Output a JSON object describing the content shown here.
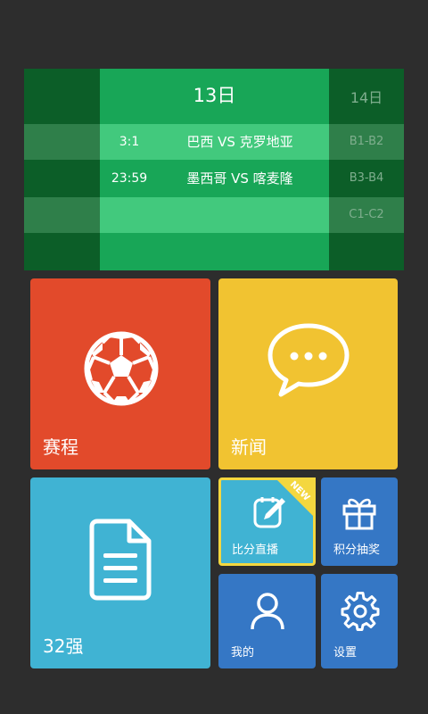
{
  "schedule_board": {
    "current_day": "13日",
    "next_day": "14日",
    "matches": [
      {
        "time": "3:1",
        "teams": "巴西 VS 克罗地亚"
      },
      {
        "time": "23:59",
        "teams": "墨西哥 VS 喀麦隆"
      }
    ],
    "groups": [
      "B1-B2",
      "B3-B4",
      "C1-C2"
    ]
  },
  "tiles": {
    "schedule": {
      "label": "赛程",
      "icon": "soccer-ball-icon",
      "color": "#e24a2b"
    },
    "news": {
      "label": "新闻",
      "icon": "chat-bubble-icon",
      "color": "#f1c331"
    },
    "top32": {
      "label": "32强",
      "icon": "document-icon",
      "color": "#40b3d3"
    },
    "live_score": {
      "label": "比分直播",
      "icon": "edit-note-icon",
      "badge": "NEW",
      "color": "#40b3d3"
    },
    "lottery": {
      "label": "积分抽奖",
      "icon": "gift-icon",
      "color": "#3577c5"
    },
    "mine": {
      "label": "我的",
      "icon": "user-icon",
      "color": "#3577c5"
    },
    "settings": {
      "label": "设置",
      "icon": "gear-icon",
      "color": "#3577c5"
    }
  }
}
